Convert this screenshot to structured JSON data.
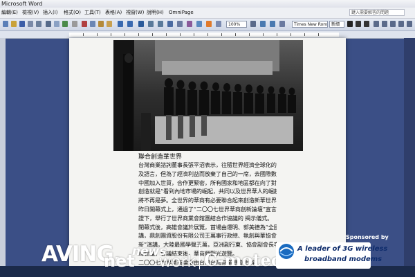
{
  "titlebar": {
    "title": "Microsoft Word"
  },
  "menubar": {
    "items": [
      "編輯(E)",
      "檢視(V)",
      "插入(I)",
      "格式(O)",
      "工具(T)",
      "表格(A)",
      "視窗(W)",
      "說明(H)",
      "OmniPage"
    ],
    "help_placeholder": "鍵入需要解答的問題"
  },
  "toolbar": {
    "zoom": "100%",
    "font": "Times New Roman",
    "size": "新細"
  },
  "document": {
    "caption": "聯合創造華世界",
    "paragraphs": [
      "台灣商業諮詢董事長張平沼表示，往隨世界經濟全球化的來臨，歐美日國家有不同程度",
      "及語言，但為了經濟利益而放棄了自己的一席，去國際數一化美與自由貿易圈已形成，來自隨",
      "中國加入世貿，合作更緊密，所有國家和地區都在向了對話交流的動態，兩岸同是由北大對",
      "創造就是“看到內地市場的崛起，共同以及世界華人的崛起，這一世紀創造中國人對世紀",
      "將不再是夢。全世界的華商有必要聯合起來創造新華世界”。",
      "昨日開幕式上，通過了“二〇〇七世界華商創新論壇”宣言，樊家共在同樂館“運明 見",
      "證下，舉行了世界商業會館團結合作協議的 揭示儀式。",
      "閉幕式後，高雄會議於展覽，首場由運明、郭美德為“全國會心先驅課程鴻圖”的講演",
      "講，鼎創團資股份有限公司王萬事行政總、執創與華協會 為“對中華文化 扮演中國 的人才",
      "新”演講，大陸最國學聲王萬，亞洲副行東、協會副會長李文庄則做行業報告，下午舉行 高",
      "峰會議，會議結束後，華商們觀光遊覽。",
      "二〇〇七世界華商論壇由台灣台灣商業總會主辦。"
    ]
  },
  "watermark": {
    "aving": "AVING.",
    "news": "news",
    "net": "net",
    "work": "work"
  },
  "sponsor": {
    "label": "Sponsored by",
    "brand": "C-motech",
    "tagline_1": "A leader of 3G wireless",
    "tagline_2": "broadband modems"
  }
}
